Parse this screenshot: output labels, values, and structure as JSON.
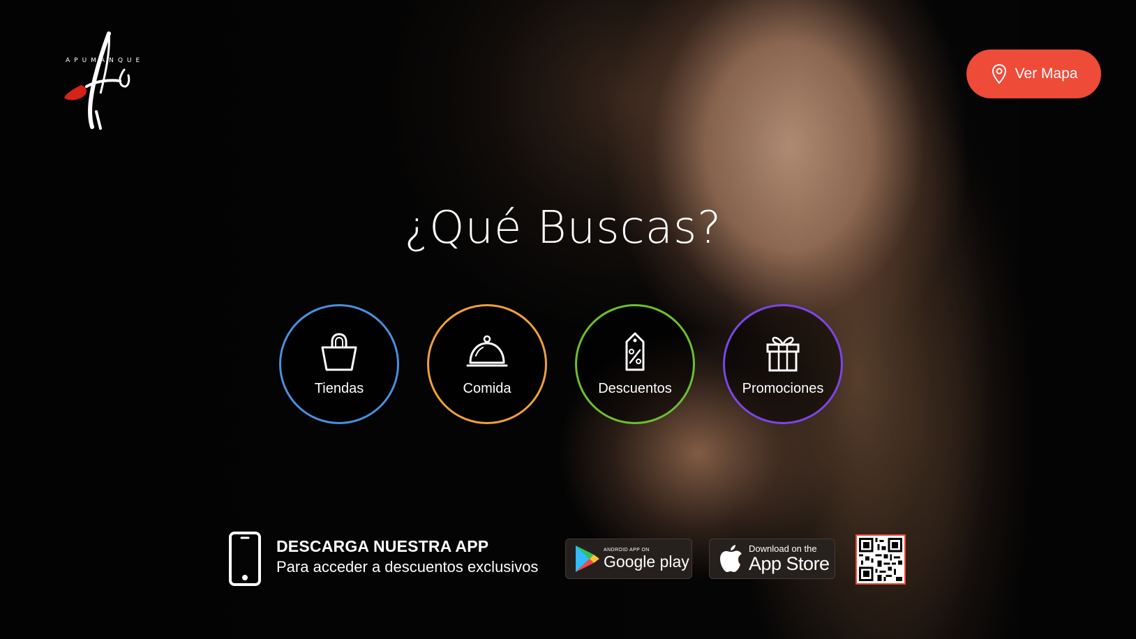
{
  "brand": {
    "wordmark": "APUMANQUE",
    "monogram": "A tu"
  },
  "header": {
    "map_button_label": "Ver Mapa",
    "map_button_icon": "location-pin-icon"
  },
  "main": {
    "title": "¿Qué Buscas?",
    "categories": [
      {
        "label": "Tiendas",
        "icon": "shopping-bag-icon",
        "ring_color": "#4a8fe0"
      },
      {
        "label": "Comida",
        "icon": "food-cloche-icon",
        "ring_color": "#f0a03c"
      },
      {
        "label": "Descuentos",
        "icon": "discount-tag-icon",
        "ring_color": "#6cbf2e"
      },
      {
        "label": "Promociones",
        "icon": "gift-icon",
        "ring_color": "#7b46e6"
      }
    ]
  },
  "app_promo": {
    "title": "DESCARGA NUESTRA APP",
    "subtitle": "Para acceder a descuentos exclusivos",
    "google_play": {
      "small": "ANDROID APP ON",
      "big": "Google play"
    },
    "app_store": {
      "small": "Download on the",
      "big": "App Store"
    }
  },
  "colors": {
    "accent": "#ee4b39"
  }
}
